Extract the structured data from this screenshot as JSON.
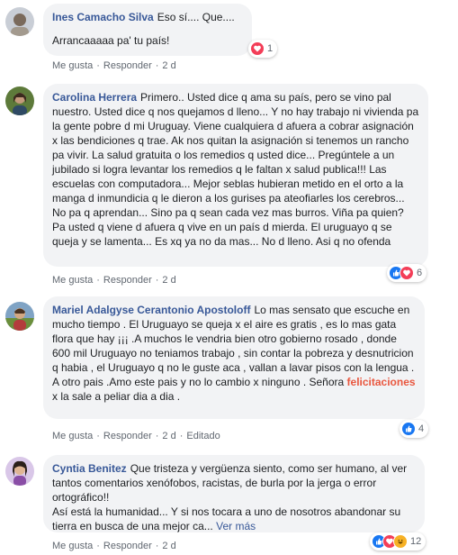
{
  "comments": [
    {
      "author": "Ines Camacho Silva",
      "text_line1": "Eso sí.... Que....",
      "text_line2": "Arrancaaaaa pa' tu país!",
      "like_label": "Me gusta",
      "reply_label": "Responder",
      "time": "2 d",
      "reaction_count": "1",
      "reactions": [
        "love"
      ]
    },
    {
      "author": "Carolina Herrera",
      "text": "Primero.. Usted dice q ama su país, pero se vino pal nuestro. Usted dice q nos quejamos d lleno... Y no hay trabajo ni vivienda pa la gente pobre d mi Uruguay. Viene cualquiera d afuera a cobrar asignación x las bendiciones q trae. Ak nos quitan la asignación si tenemos un rancho pa vivir. La salud gratuita o los remedios q usted dice... Pregúntele a un jubilado si logra levantar los remedios q le faltan x salud publica!!! Las escuelas con computadora... Mejor seblas hubieran metido en el orto a la manga d inmundicia q le dieron a los gurises pa ateofiarles los cerebros... No pa q aprendan... Sino pa q sean cada vez mas burros. Viña pa quien? Pa usted q viene d afuera q vive en un país d mierda. El uruguayo q se queja y se lamenta... Es xq ya no da mas... No d lleno. Asi q no ofenda",
      "like_label": "Me gusta",
      "reply_label": "Responder",
      "time": "2 d",
      "reaction_count": "6",
      "reactions": [
        "like",
        "love"
      ]
    },
    {
      "author": "Mariel Adalgyse Cerantonio Apostoloff",
      "text_before": "Lo mas sensato que escuche en mucho tiempo . El Uruguayo se queja x el aire es gratis , es lo mas gata flora que hay ¡¡¡ .A muchos le vendria bien otro gobierno rosado , donde 600 mil Uruguayo no teniamos trabajo , sin contar la pobreza y desnutricion q habia , el Uruguayo q no le guste aca , vallan a lavar pisos con la lengua . A otro pais .Amo este pais y no lo cambio x ninguno . Señora",
      "highlight": "felicitaciones",
      "text_after": "x la sale a peliar dia a dia .",
      "like_label": "Me gusta",
      "reply_label": "Responder",
      "time": "2 d",
      "edited_label": "Editado",
      "reaction_count": "4",
      "reactions": [
        "like"
      ]
    },
    {
      "author": "Cyntia Benitez",
      "text_line1": "Que tristeza y vergüenza siento, como ser humano, al ver tantos comentarios xenófobos, racistas, de burla por la jerga o error ortográfico!!",
      "text_line2": "Así está la humanidad... Y si nos tocara a uno de nosotros abandonar su tierra en busca de una mejor ca...",
      "see_more": "Ver más",
      "like_label": "Me gusta",
      "reply_label": "Responder",
      "time": "2 d",
      "reaction_count": "12",
      "reactions": [
        "like",
        "love",
        "haha"
      ]
    }
  ],
  "colors": {
    "author": "#385898",
    "bubble": "#f2f3f5",
    "highlight": "#e9573f",
    "like": "#1877f2",
    "love": "#f33e58",
    "haha": "#f7b125"
  }
}
